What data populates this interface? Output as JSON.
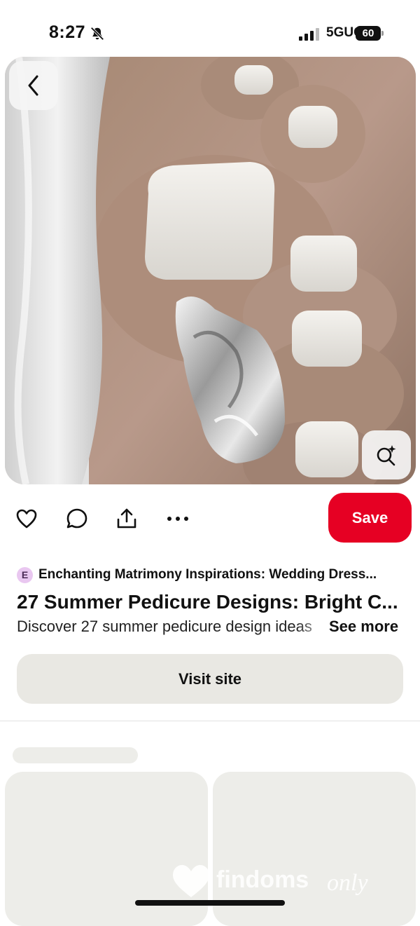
{
  "status_bar": {
    "time": "8:27",
    "network": "5GUC",
    "battery": "60"
  },
  "pin": {
    "image_description_icon": "toe-ring-pedicure-image",
    "board_badge": "E",
    "board_name": "Enchanting Matrimony Inspirations: Wedding Dress...",
    "title": "27 Summer Pedicure Designs: Bright C...",
    "description": "Discover 27 summer pedicure design ideas",
    "see_more": "See more",
    "visit_label": "Visit site"
  },
  "actions": {
    "save_label": "Save",
    "icons": [
      "heart-icon",
      "comment-icon",
      "share-icon",
      "more-icon"
    ]
  },
  "watermark": {
    "brand": "findoms",
    "brand_script": "only"
  },
  "colors": {
    "save": "#e60023",
    "visit_bg": "#e9e8e3",
    "skeleton": "#edede9"
  }
}
